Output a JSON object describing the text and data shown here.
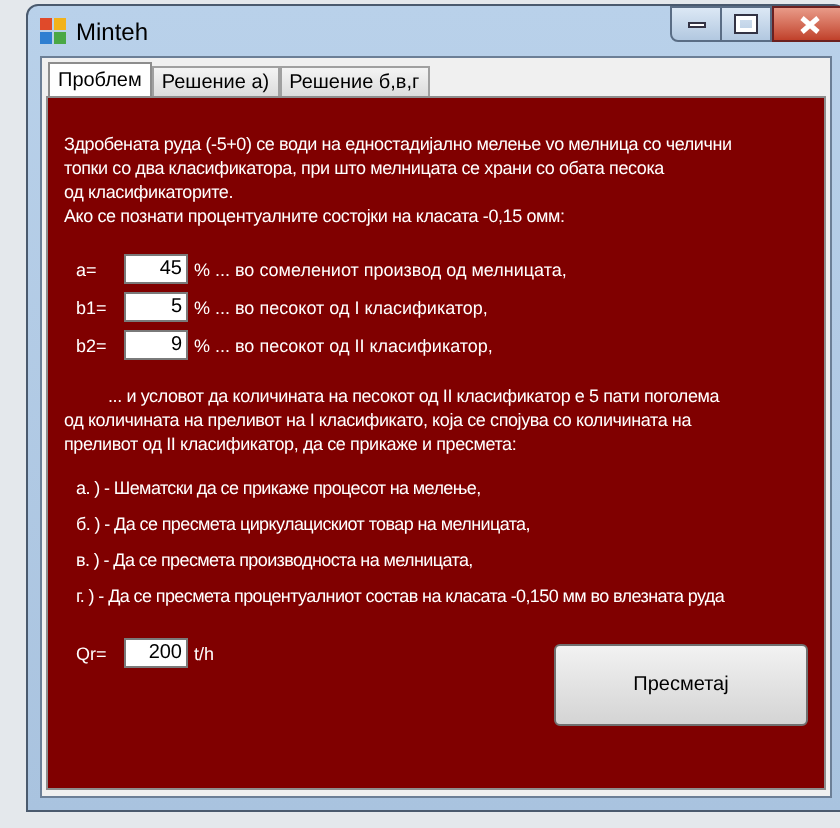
{
  "window": {
    "title": "Minteh"
  },
  "tabs": [
    {
      "label": "Проблем",
      "selected": true
    },
    {
      "label": "Решение а)",
      "selected": false
    },
    {
      "label": "Решение б,в,г",
      "selected": false
    }
  ],
  "intro": "Здробената руда (-5+0) се води на едностадијално мелење vo мелница со челични\nтопки со два класификатора, при што мелницата се храни со обата песока\nод класификаторите.\nАко се познати процентуалните состојки на класата -0,15 омм:",
  "inputs": [
    {
      "label": "a=",
      "value": "45",
      "description": "% ... во сомелениот производ од мелницата,"
    },
    {
      "label": "b1=",
      "value": "5",
      "description": "% ... во песокот од I класификатор,"
    },
    {
      "label": "b2=",
      "value": "9",
      "description": "% ... во песокот од II класификатор,"
    }
  ],
  "condition": "... и условот да количината на песокот од II класификатор е 5 пати поголема\nод количината на преливот на I класификато, која се спојува со количината на\nпреливот од II класификатор, да се прикаже и пресмета:",
  "tasks": [
    "а. ) - Шематски да се прикаже процесот на мелење,",
    "б. ) - Да се пресмета циркулацискиот товар на мелницата,",
    "в. ) - Да се пресмета производноста на мелницата,",
    "г. ) - Да се пресмета процентуалниот состав на класата -0,150 мм во влезната руда"
  ],
  "capacity": {
    "label": "Qr=",
    "value": "200",
    "unit": "t/h"
  },
  "button": "Пресметај"
}
